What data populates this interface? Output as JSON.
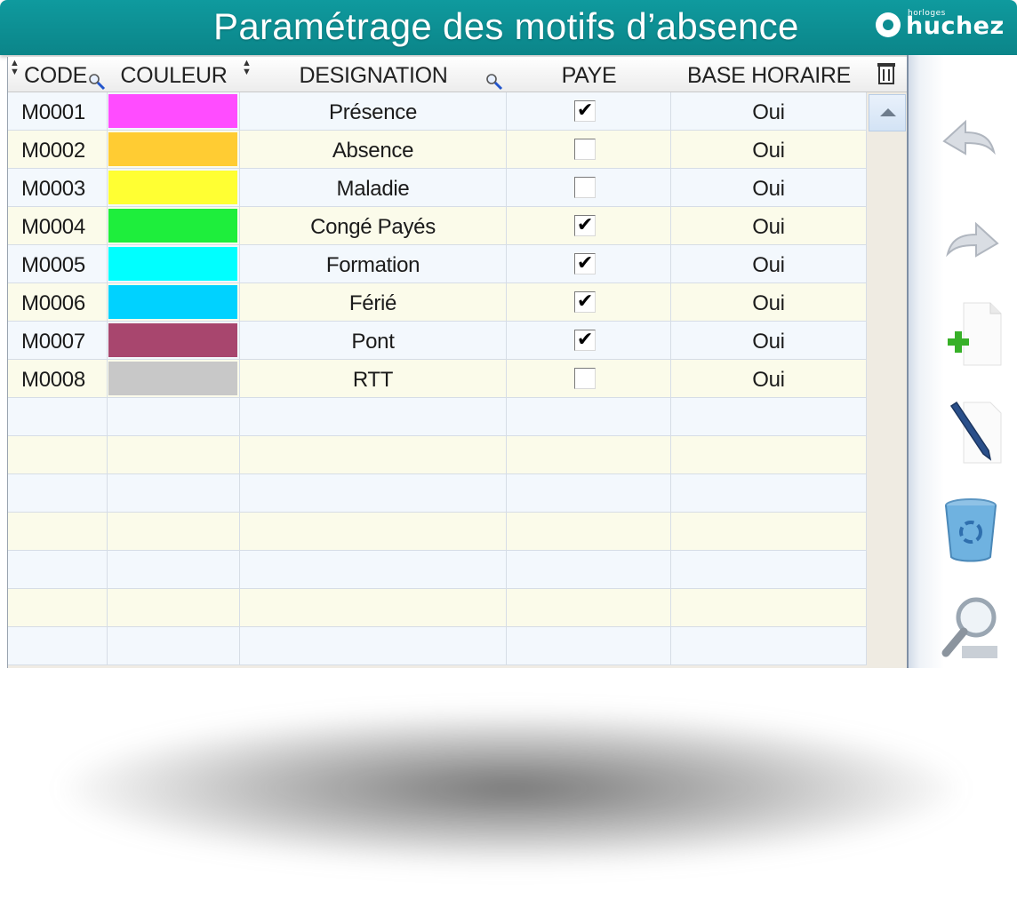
{
  "window": {
    "title": "Paramétrage des motifs d’absence",
    "logo_small": "horloges",
    "logo_name": "huchez"
  },
  "grid": {
    "columns": [
      "CODE",
      "COULEUR",
      "DESIGNATION",
      "PAYE",
      "BASE HORAIRE"
    ],
    "rows": [
      {
        "code": "M0001",
        "color": "#ff4cff",
        "designation": "Présence",
        "paye": true,
        "base_horaire": "Oui",
        "selected": true
      },
      {
        "code": "M0002",
        "color": "#ffcc33",
        "designation": "Absence",
        "paye": false,
        "base_horaire": "Oui",
        "selected": false
      },
      {
        "code": "M0003",
        "color": "#ffff33",
        "designation": "Maladie",
        "paye": false,
        "base_horaire": "Oui",
        "selected": false
      },
      {
        "code": "M0004",
        "color": "#1eee3c",
        "designation": "Congé Payés",
        "paye": true,
        "base_horaire": "Oui",
        "selected": false
      },
      {
        "code": "M0005",
        "color": "#00ffff",
        "designation": "Formation",
        "paye": true,
        "base_horaire": "Oui",
        "selected": false
      },
      {
        "code": "M0006",
        "color": "#00d2ff",
        "designation": "Férié",
        "paye": true,
        "base_horaire": "Oui",
        "selected": false
      },
      {
        "code": "M0007",
        "color": "#a8466e",
        "designation": "Pont",
        "paye": true,
        "base_horaire": "Oui",
        "selected": false
      },
      {
        "code": "M0008",
        "color": "#c8c8c8",
        "designation": "RTT",
        "paye": false,
        "base_horaire": "Oui",
        "selected": false
      }
    ],
    "empty_rows": 7,
    "row_colors": [
      "#f3f8fd",
      "#fbfbea"
    ]
  },
  "toolbar": {
    "tools": [
      "previous-icon",
      "next-icon",
      "add-icon",
      "edit-icon",
      "delete-icon",
      "search-icon"
    ]
  },
  "colors": {
    "titlebar": "#0d8d91",
    "selected_row": "#cfe0f7"
  }
}
